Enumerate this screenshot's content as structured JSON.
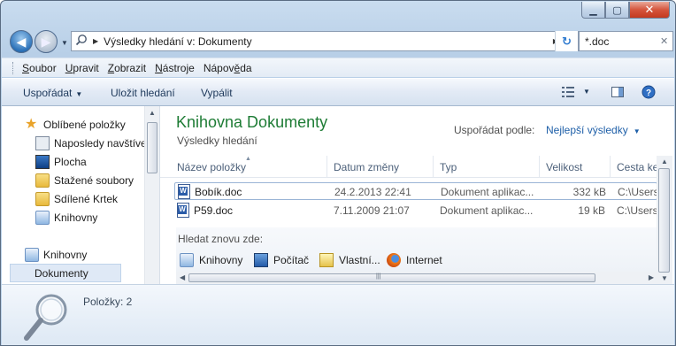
{
  "window": {
    "caption_buttons": {
      "minimize": "▁",
      "maximize": "▢",
      "close": "✕"
    }
  },
  "address": {
    "path": "Výsledky hledání v: Dokumenty",
    "search_value": "*.doc"
  },
  "menu": [
    {
      "label_rest": "oubor",
      "accel": "S"
    },
    {
      "label_rest": "pravit",
      "accel": "U"
    },
    {
      "label_rest": "obrazit",
      "accel": "Z"
    },
    {
      "label_rest": "ástroje",
      "accel": "N"
    },
    {
      "label_pre": "Nápov",
      "accel": "ě",
      "label_rest": "da"
    }
  ],
  "toolbar": {
    "organize": "Uspořádat",
    "save_search": "Uložit hledání",
    "burn": "Vypálit"
  },
  "nav": {
    "items": [
      {
        "label": "Oblíbené položky",
        "icon": "star-icon"
      },
      {
        "label": "Naposledy navštíve",
        "icon": "recent-places-icon"
      },
      {
        "label": "Plocha",
        "icon": "desktop-icon"
      },
      {
        "label": "Stažené soubory",
        "icon": "downloads-folder-icon"
      },
      {
        "label": "Sdílené Krtek",
        "icon": "shared-folder-icon"
      },
      {
        "label": "Knihovny",
        "icon": "libraries-icon"
      },
      {
        "label": "Knihovny",
        "icon": "libraries-icon"
      },
      {
        "label": "Dokumenty",
        "icon": "documents-library-icon"
      }
    ]
  },
  "library": {
    "title": "Knihovna Dokumenty",
    "subtitle": "Výsledky hledání",
    "arrange_label": "Uspořádat podle:",
    "arrange_value": "Nejlepší výsledky"
  },
  "columns": {
    "name": "Název položky",
    "date": "Datum změny",
    "type": "Typ",
    "size": "Velikost",
    "path": "Cesta ke"
  },
  "files": [
    {
      "name": "Bobík.doc",
      "date": "24.2.2013 22:41",
      "type": "Dokument aplikac...",
      "size": "332 kB",
      "path": "C:\\Users"
    },
    {
      "name": "P59.doc",
      "date": "7.11.2009 21:07",
      "type": "Dokument aplikac...",
      "size": "19 kB",
      "path": "C:\\Users"
    }
  ],
  "search_again": {
    "label": "Hledat znovu zde:",
    "targets": [
      "Knihovny",
      "Počítač",
      "Vlastní...",
      "Internet"
    ]
  },
  "details": {
    "items_count": "Položky: 2"
  }
}
